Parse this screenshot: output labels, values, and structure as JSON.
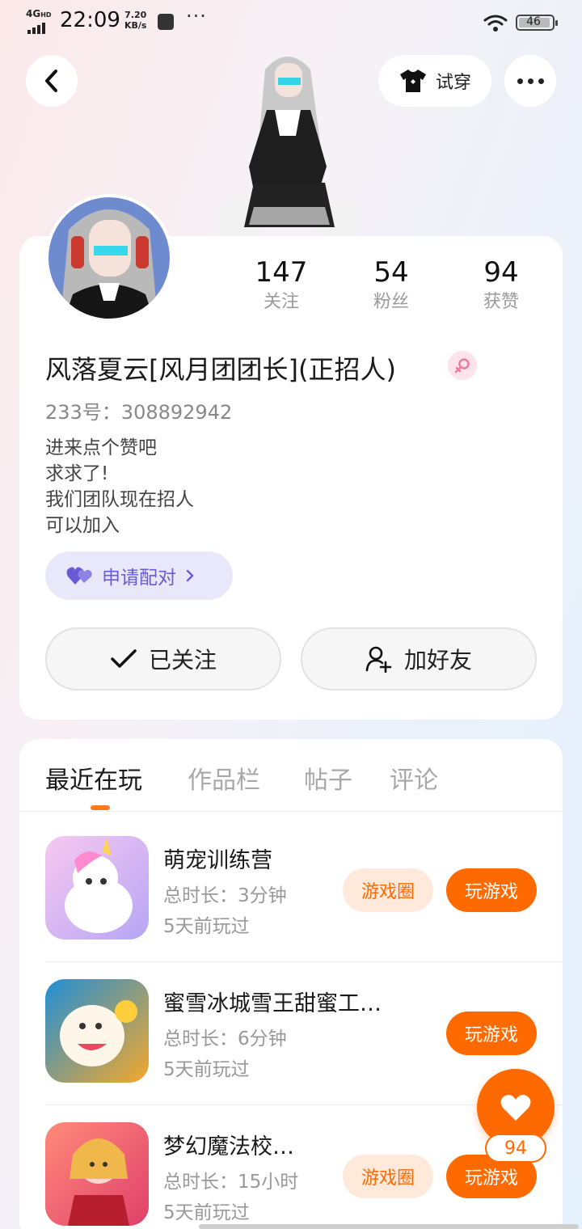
{
  "status_bar": {
    "network": "4G",
    "network_badge": "HD",
    "time": "22:09",
    "speed_value": "7.20",
    "speed_unit": "KB/s",
    "more": "···",
    "battery": "46"
  },
  "header": {
    "tryon_label": "试穿"
  },
  "profile": {
    "stats": [
      {
        "num": "147",
        "label": "关注"
      },
      {
        "num": "54",
        "label": "粉丝"
      },
      {
        "num": "94",
        "label": "获赞"
      }
    ],
    "nickname": "风落夏云[风月团团长](正招人)",
    "user_id": "233号：308892942",
    "bio": [
      "进来点个赞吧",
      "求求了!",
      "我们团队现在招人",
      "可以加入"
    ],
    "pair_label": "申请配对",
    "follow_label": "已关注",
    "friend_label": "加好友"
  },
  "tabs": [
    "最近在玩",
    "作品栏",
    "帖子",
    "评论"
  ],
  "games": [
    {
      "name": "萌宠训练营",
      "duration": "总时长：3分钟",
      "last_played": "5天前玩过",
      "circle_label": "游戏圈",
      "play_label": "玩游戏"
    },
    {
      "name": "蜜雪冰城雪王甜蜜工…",
      "duration": "总时长：6分钟",
      "last_played": "5天前玩过",
      "circle_label": "",
      "play_label": "玩游戏"
    },
    {
      "name": "梦幻魔法校…",
      "duration": "总时长：15小时",
      "last_played": "5天前玩过",
      "circle_label": "游戏圈",
      "play_label": "玩游戏"
    }
  ],
  "like_count": "94",
  "colors": {
    "accent": "#ff6a00",
    "pair_purple": "#6a5ad6",
    "gender_pink": "#f07aa0"
  }
}
